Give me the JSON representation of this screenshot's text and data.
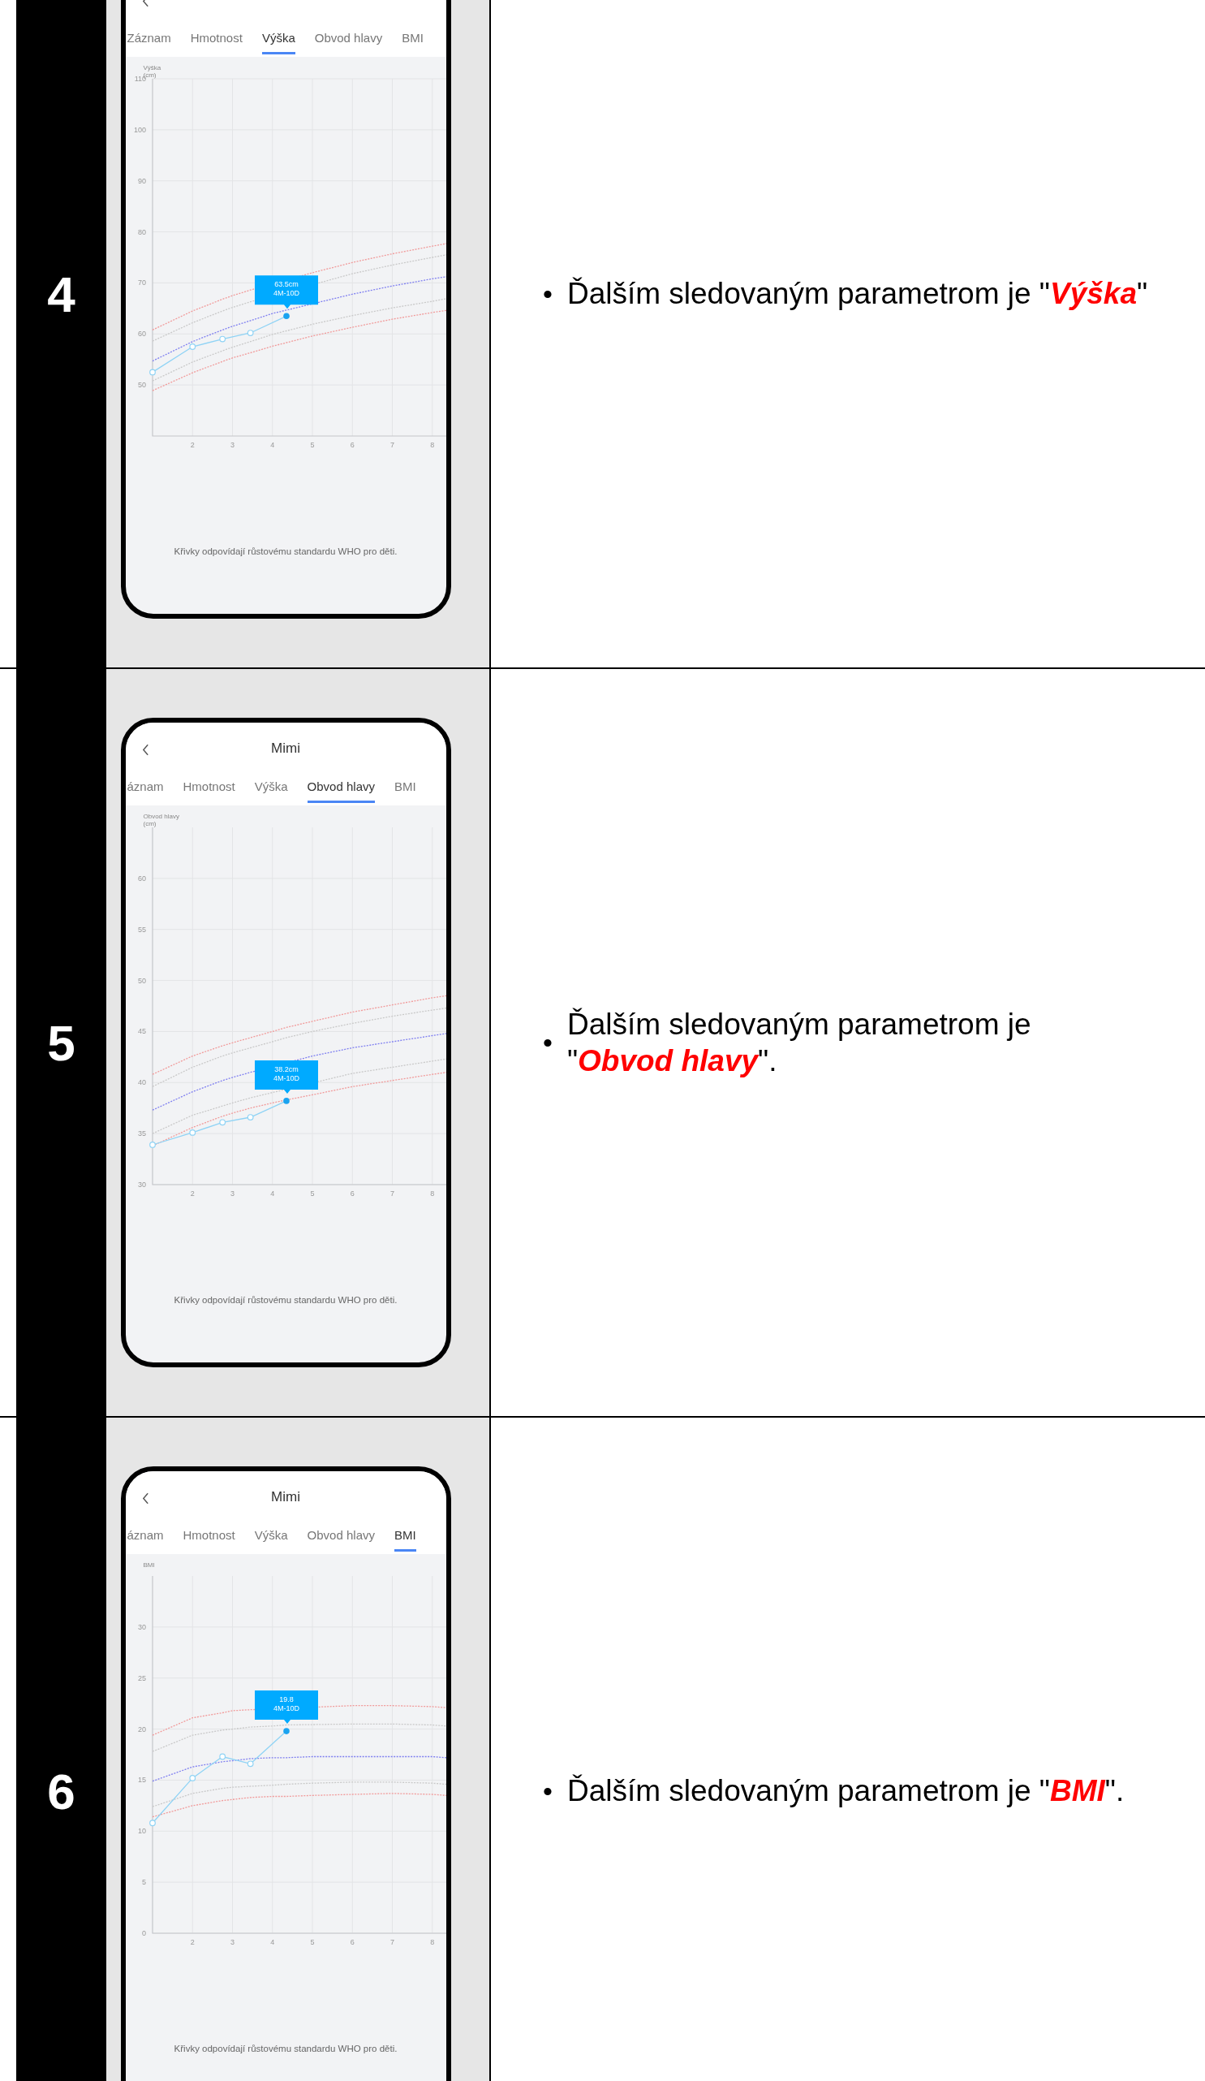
{
  "rows": [
    {
      "number": "4",
      "phone": {
        "tabs": [
          {
            "label": "Záznam",
            "selected": false
          },
          {
            "label": "Hmotnost",
            "selected": false
          },
          {
            "label": "Výška",
            "selected": true
          },
          {
            "label": "Obvod hlavy",
            "selected": false
          },
          {
            "label": "BMI",
            "selected": false
          }
        ],
        "chart_data": {
          "type": "line",
          "grid": true,
          "ylabel": "Výška\n(cm)",
          "x": [
            1,
            2,
            2.75,
            3,
            3.45,
            4,
            4.35,
            5,
            6,
            7,
            8,
            8.35
          ],
          "xlim": [
            1,
            8.35
          ],
          "ylim": [
            40,
            110
          ],
          "xticks": [
            2,
            3,
            4,
            5,
            6,
            7,
            8
          ],
          "yticks": [
            50,
            60,
            70,
            80,
            90,
            100,
            110
          ],
          "series": [
            {
              "line_style": "dashed",
              "color": "#f19a9a",
              "values": [
                60.8,
                64.5,
                66.8,
                67.5,
                68.6,
                null,
                null,
                72,
                74,
                75.7,
                77.2,
                77.7
              ]
            },
            {
              "line_style": "dashed",
              "color": "#c9c9c9",
              "values": [
                58.6,
                62.2,
                64.5,
                65.2,
                66.3,
                null,
                null,
                null,
                71.8,
                73.5,
                75,
                75.5
              ]
            },
            {
              "line_style": "dashed",
              "color": "#7f7ff0",
              "values": [
                54.7,
                58.5,
                60.8,
                61.5,
                62.6,
                64,
                null,
                null,
                67.8,
                69.4,
                70.8,
                71.2
              ]
            },
            {
              "line_style": "dashed",
              "color": "#c9c9c9",
              "values": [
                50.8,
                54.5,
                56.7,
                57.4,
                58.5,
                59.9,
                60.6,
                61.9,
                63.6,
                65.1,
                66.4,
                66.9
              ]
            },
            {
              "line_style": "dashed",
              "color": "#f19a9a",
              "values": [
                48.9,
                52.4,
                54.6,
                55.3,
                56.3,
                57.6,
                58.3,
                59.6,
                61.3,
                62.9,
                64.2,
                64.6
              ]
            },
            {
              "line_style": "solid",
              "marker": "circle",
              "color": "#8fd3f5",
              "values": [
                52.5,
                57.5,
                59,
                null,
                60.2,
                null,
                63.5,
                null,
                null,
                null,
                null,
                null
              ]
            }
          ]
        },
        "tooltip": {
          "value": "63.5cm",
          "age": "4M-10D"
        },
        "caption": "Křivky odpovídají růstovému standardu WHO pro děti."
      },
      "bullet": "•",
      "text": {
        "before": "Ďalším sledovaným parametrom je ",
        "open": "\"",
        "highlight": "Výška",
        "after": "\""
      }
    },
    {
      "number": "5",
      "phone": {
        "title": "Mimi",
        "tabs": [
          {
            "label": "áznam",
            "selected": false
          },
          {
            "label": "Hmotnost",
            "selected": false
          },
          {
            "label": "Výška",
            "selected": false
          },
          {
            "label": "Obvod hlavy",
            "selected": true
          },
          {
            "label": "BMI",
            "selected": false
          }
        ],
        "chart_data": {
          "type": "line",
          "grid": true,
          "ylabel": "Obvod hlavy\n(cm)",
          "x": [
            1,
            2,
            2.75,
            3,
            3.45,
            4,
            4.35,
            5,
            6,
            7,
            8,
            8.35
          ],
          "xlim": [
            1,
            8.35
          ],
          "ylim": [
            30,
            65
          ],
          "xticks": [
            2,
            3,
            4,
            5,
            6,
            7,
            8
          ],
          "yticks": [
            30,
            35,
            40,
            45,
            50,
            55,
            60
          ],
          "series": [
            {
              "line_style": "dashed",
              "color": "#f19a9a",
              "values": [
                40.8,
                42.6,
                43.6,
                43.9,
                44.4,
                45,
                45.4,
                46,
                46.9,
                47.6,
                48.3,
                48.5
              ]
            },
            {
              "line_style": "dashed",
              "color": "#c9c9c9",
              "values": [
                39.6,
                41.5,
                42.6,
                42.9,
                43.4,
                44,
                44.4,
                45,
                45.8,
                46.5,
                47.1,
                47.3
              ]
            },
            {
              "line_style": "dashed",
              "color": "#7f7ff0",
              "values": [
                37.3,
                39.1,
                40.2,
                40.5,
                41,
                null,
                null,
                42.6,
                43.4,
                44,
                44.6,
                44.8
              ]
            },
            {
              "line_style": "dashed",
              "color": "#c9c9c9",
              "values": [
                35,
                36.8,
                37.7,
                38,
                38.5,
                null,
                null,
                null,
                40.9,
                41.5,
                42.1,
                42.3
              ]
            },
            {
              "line_style": "dashed",
              "color": "#f19a9a",
              "values": [
                33.8,
                35.6,
                36.7,
                37,
                37.5,
                38,
                38.3,
                38.8,
                39.6,
                40.2,
                40.8,
                41
              ]
            },
            {
              "line_style": "solid",
              "marker": "circle",
              "color": "#8fd3f5",
              "values": [
                33.9,
                35.1,
                36.1,
                null,
                36.6,
                null,
                38.2,
                null,
                null,
                null,
                null,
                null
              ]
            }
          ]
        },
        "tooltip": {
          "value": "38.2cm",
          "age": "4M-10D"
        },
        "caption": "Křivky odpovídají růstovému standardu WHO pro děti."
      },
      "bullet": "•",
      "text": {
        "before": "Ďalším sledovaným parametrom je ",
        "open": "\"",
        "highlight": "Obvod hlavy",
        "after": "\"."
      }
    },
    {
      "number": "6",
      "phone": {
        "title": "Mimi",
        "tabs": [
          {
            "label": "áznam",
            "selected": false
          },
          {
            "label": "Hmotnost",
            "selected": false
          },
          {
            "label": "Výška",
            "selected": false
          },
          {
            "label": "Obvod hlavy",
            "selected": false
          },
          {
            "label": "BMI",
            "selected": true
          }
        ],
        "chart_data": {
          "type": "line",
          "grid": true,
          "ylabel": "BMI",
          "x": [
            1,
            2,
            2.75,
            3,
            3.45,
            4,
            4.35,
            5,
            6,
            7,
            8,
            8.35
          ],
          "xlim": [
            1,
            8.35
          ],
          "ylim": [
            0,
            35
          ],
          "xticks": [
            2,
            3,
            4,
            5,
            6,
            7,
            8
          ],
          "yticks": [
            0,
            5,
            10,
            15,
            20,
            25,
            30
          ],
          "series": [
            {
              "line_style": "dashed",
              "color": "#f19a9a",
              "values": [
                19.4,
                21.1,
                21.6,
                21.8,
                21.9,
                null,
                null,
                null,
                22.3,
                22.3,
                22.2,
                22.1
              ]
            },
            {
              "line_style": "dashed",
              "color": "#c9c9c9",
              "values": [
                17.8,
                19.4,
                19.9,
                20,
                20.2,
                20.3,
                20.4,
                null,
                20.5,
                20.5,
                20.4,
                20.3
              ]
            },
            {
              "line_style": "dashed",
              "color": "#7f7ff0",
              "values": [
                14.9,
                16.3,
                16.8,
                16.9,
                17.1,
                17.2,
                17.2,
                17.3,
                17.3,
                17.3,
                17.3,
                17.2
              ]
            },
            {
              "line_style": "dashed",
              "color": "#c9c9c9",
              "values": [
                12.4,
                13.7,
                14.2,
                14.3,
                14.4,
                14.5,
                14.6,
                14.7,
                14.8,
                14.8,
                14.7,
                14.6
              ]
            },
            {
              "line_style": "dashed",
              "color": "#f19a9a",
              "values": [
                11.4,
                12.5,
                13,
                13.1,
                13.3,
                13.4,
                13.4,
                13.5,
                13.6,
                13.7,
                13.6,
                13.5
              ]
            },
            {
              "line_style": "solid",
              "marker": "circle",
              "color": "#8fd3f5",
              "values": [
                10.8,
                15.2,
                17.3,
                null,
                16.6,
                null,
                19.8,
                null,
                null,
                null,
                null,
                null
              ]
            }
          ]
        },
        "tooltip": {
          "value": "19.8",
          "age": "4M-10D"
        },
        "caption": "Křivky odpovídají růstovému standardu WHO pro děti."
      },
      "bullet": "•",
      "text": {
        "before": "Ďalším sledovaným parametrom je ",
        "open": "\"",
        "highlight": "BMI",
        "after": "\"."
      }
    }
  ]
}
